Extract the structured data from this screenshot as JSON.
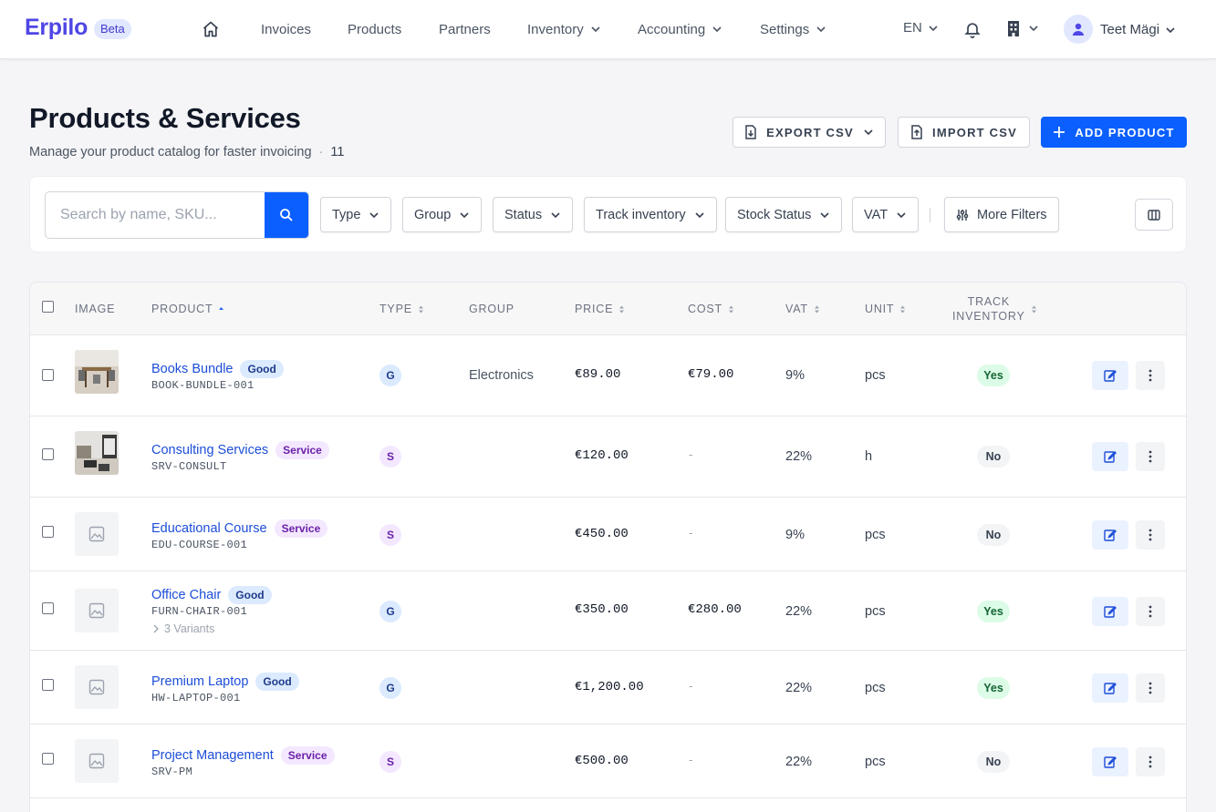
{
  "app": {
    "logo": "Erpilo",
    "badge": "Beta"
  },
  "nav": {
    "items": [
      {
        "label": "Invoices"
      },
      {
        "label": "Products"
      },
      {
        "label": "Partners"
      },
      {
        "label": "Inventory"
      },
      {
        "label": "Accounting"
      },
      {
        "label": "Settings"
      }
    ],
    "language": "EN",
    "user": "Teet Mägi"
  },
  "header": {
    "title": "Products & Services",
    "subtitle": "Manage your product catalog for faster invoicing",
    "count": "11",
    "export_label": "EXPORT CSV",
    "import_label": "IMPORT CSV",
    "add_label": "ADD PRODUCT"
  },
  "filters": {
    "search_placeholder": "Search by name, SKU...",
    "type": "Type",
    "group": "Group",
    "status": "Status",
    "track_inventory": "Track inventory",
    "stock_status": "Stock Status",
    "vat": "VAT",
    "more": "More Filters"
  },
  "table": {
    "headers": {
      "image": "IMAGE",
      "product": "PRODUCT",
      "type": "TYPE",
      "group": "GROUP",
      "price": "PRICE",
      "cost": "COST",
      "vat": "VAT",
      "unit": "UNIT",
      "track_line1": "TRACK",
      "track_line2": "INVENTORY"
    },
    "rows": [
      {
        "name": "Books Bundle",
        "badge": "Good",
        "sku": "BOOK-BUNDLE-001",
        "type": "G",
        "group": "Electronics",
        "price": "€89.00",
        "cost": "€79.00",
        "vat": "9%",
        "unit": "pcs",
        "track": "Yes"
      },
      {
        "name": "Consulting Services",
        "badge": "Service",
        "sku": "SRV-CONSULT",
        "type": "S",
        "group": "",
        "price": "€120.00",
        "cost": "-",
        "vat": "22%",
        "unit": "h",
        "track": "No"
      },
      {
        "name": "Educational Course",
        "badge": "Service",
        "sku": "EDU-COURSE-001",
        "type": "S",
        "group": "",
        "price": "€450.00",
        "cost": "-",
        "vat": "9%",
        "unit": "pcs",
        "track": "No"
      },
      {
        "name": "Office Chair",
        "badge": "Good",
        "sku": "FURN-CHAIR-001",
        "variants": "3 Variants",
        "type": "G",
        "group": "",
        "price": "€350.00",
        "cost": "€280.00",
        "vat": "22%",
        "unit": "pcs",
        "track": "Yes"
      },
      {
        "name": "Premium Laptop",
        "badge": "Good",
        "sku": "HW-LAPTOP-001",
        "type": "G",
        "group": "",
        "price": "€1,200.00",
        "cost": "-",
        "vat": "22%",
        "unit": "pcs",
        "track": "Yes"
      },
      {
        "name": "Project Management",
        "badge": "Service",
        "sku": "SRV-PM",
        "type": "S",
        "group": "",
        "price": "€500.00",
        "cost": "-",
        "vat": "22%",
        "unit": "pcs",
        "track": "No"
      }
    ]
  },
  "colors": {
    "primary": "#0b5fff",
    "brand": "#4f46e5"
  },
  "icons": [
    "home-icon",
    "chevron-down-icon",
    "bell-icon",
    "building-icon",
    "user-icon",
    "file-download-icon",
    "file-upload-icon",
    "plus-icon",
    "search-icon",
    "sliders-icon",
    "columns-icon",
    "image-placeholder-icon",
    "edit-icon",
    "more-vertical-icon",
    "sort-icon"
  ]
}
